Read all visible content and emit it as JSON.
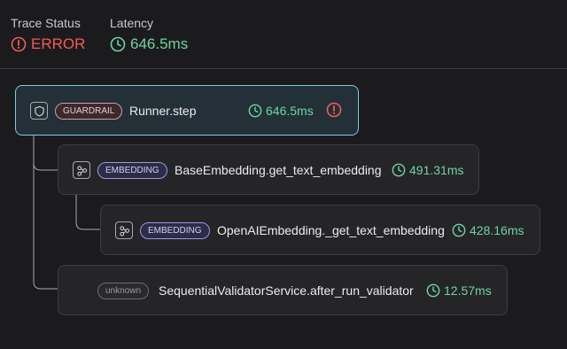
{
  "header": {
    "trace_status_label": "Trace Status",
    "trace_status_value": "ERROR",
    "latency_label": "Latency",
    "latency_value": "646.5ms"
  },
  "colors": {
    "error": "#f05a5a",
    "success": "#6fd3a0",
    "selected_border": "#7fc9e3",
    "guardrail": "#d49a9e",
    "embedding": "#9a9ae0",
    "unknown": "#6c6c71"
  },
  "spans": [
    {
      "kind": "GUARDRAIL",
      "icon": "shield-icon",
      "name": "Runner.step",
      "latency": "646.5ms",
      "has_error": true,
      "selected": true
    },
    {
      "kind": "EMBEDDING",
      "icon": "embedding-icon",
      "name": "BaseEmbedding.get_text_embedding",
      "latency": "491.31ms",
      "has_error": false,
      "selected": false
    },
    {
      "kind": "EMBEDDING",
      "icon": "embedding-icon",
      "name": "OpenAIEmbedding._get_text_embedding",
      "latency": "428.16ms",
      "has_error": false,
      "selected": false
    },
    {
      "kind": "unknown",
      "icon": "",
      "name": "SequentialValidatorService.after_run_validator",
      "latency": "12.57ms",
      "has_error": false,
      "selected": false
    }
  ]
}
